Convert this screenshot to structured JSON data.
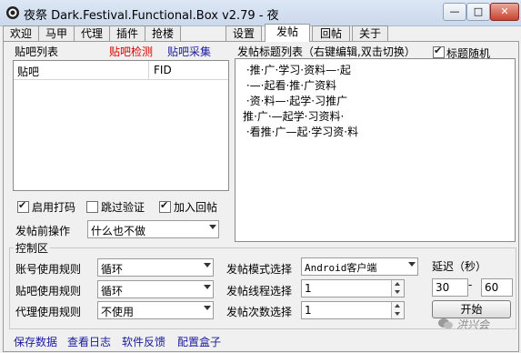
{
  "window": {
    "title": "夜祭 Dark.Festival.Functional.Box v2.79 - 夜",
    "minimize_glyph": "—",
    "maximize_glyph": "□",
    "close_glyph": "✕"
  },
  "tabs": [
    {
      "label": "欢迎"
    },
    {
      "label": "马甲"
    },
    {
      "label": "代理"
    },
    {
      "label": "插件"
    },
    {
      "label": "抢楼"
    },
    {
      "label": "设置"
    },
    {
      "label": "发帖"
    },
    {
      "label": "回帖"
    },
    {
      "label": "关于"
    }
  ],
  "active_tab": "发帖",
  "bar_list": {
    "title": "贴吧列表",
    "detect_link": "贴吧检测",
    "collect_link": "贴吧采集",
    "columns": [
      "贴吧",
      "FID"
    ],
    "rows": []
  },
  "options": {
    "enable_captcha": {
      "label": "启用打码",
      "checked": true
    },
    "skip_verify": {
      "label": "跳过验证",
      "checked": false
    },
    "add_reply": {
      "label": "加入回帖",
      "checked": true
    }
  },
  "post_action": {
    "label": "发帖前操作",
    "value": "什么也不做"
  },
  "titles_panel": {
    "header": "发帖标题列表（右键编辑,双击切换）",
    "random_label": "标题随机",
    "random_checked": true,
    "lines": [
      " ·推·广·学习·资料—·起",
      " ·—·起看·推·广资料",
      " ·资·料—·起学·习推广",
      "推·广·—起学·习资料·",
      " ·看推·广—起·学习资·料"
    ]
  },
  "control": {
    "title": "控制区",
    "account_rule": {
      "label": "账号使用规则",
      "value": "循环"
    },
    "bar_rule": {
      "label": "贴吧使用规则",
      "value": "循环"
    },
    "proxy_rule": {
      "label": "代理使用规则",
      "value": "不使用"
    },
    "post_mode": {
      "label": "发帖模式选择",
      "value": "Android客户端"
    },
    "thread_count": {
      "label": "发帖线程选择",
      "value": "1"
    },
    "post_count": {
      "label": "发帖次数选择",
      "value": "1"
    },
    "delay": {
      "label": "延迟（秒）",
      "min": "30",
      "separator": "-",
      "max": "60"
    },
    "start_label": "开始"
  },
  "footer": {
    "save": "保存数据",
    "log": "查看日志",
    "feedback": "软件反馈",
    "config": "配置盒子"
  },
  "watermark": "洪兴会",
  "colors": {
    "red_link": "#e00000",
    "blue_link": "#1a1aa0",
    "footer_link": "#1a1aa0"
  }
}
